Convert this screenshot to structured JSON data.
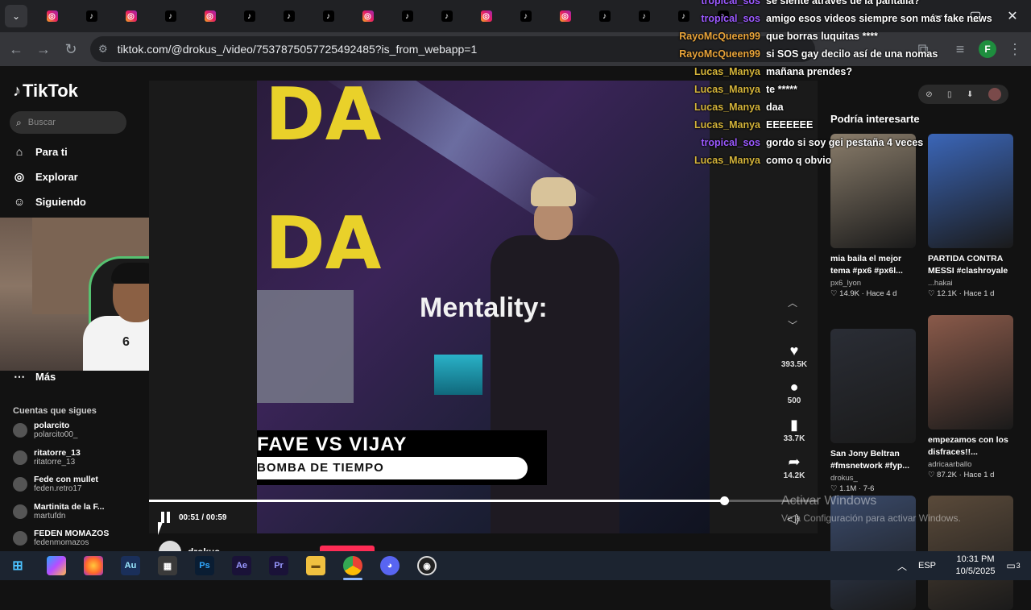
{
  "browser": {
    "url": "tiktok.com/@drokus_/video/7537875057725492485?is_from_webapp=1",
    "profile_initial": "F",
    "tab_favicons": [
      "ig",
      "tk",
      "ig",
      "tk",
      "ig",
      "tk",
      "tk",
      "tk",
      "ig",
      "tk",
      "tk",
      "ig",
      "tk",
      "ig",
      "tk",
      "tk",
      "tk",
      "tk"
    ]
  },
  "tiktok": {
    "logo": "TikTok",
    "search_placeholder": "Buscar",
    "nav": [
      {
        "label": "Para ti",
        "icon": "home-icon"
      },
      {
        "label": "Explorar",
        "icon": "compass-icon"
      },
      {
        "label": "Siguiendo",
        "icon": "people-icon"
      },
      {
        "label": "Más",
        "icon": "more-icon"
      }
    ],
    "following_title": "Cuentas que sigues",
    "following": [
      {
        "name": "polarcito",
        "handle": "polarcito00_"
      },
      {
        "name": "ritatorre_13",
        "handle": "ritatorre_13"
      },
      {
        "name": "Fede con mullet",
        "handle": "feden.retro17"
      },
      {
        "name": "Martinita de la F...",
        "handle": "martufdn"
      },
      {
        "name": "FEDEN MOMAZOS",
        "handle": "fedenmomazos"
      }
    ],
    "video": {
      "overlay_text": "Mentality:",
      "lower_third_title": "FAVE VS VIJAY",
      "lower_third_sub": "BOMBA DE TIEMPO",
      "time": "00:51 / 00:59",
      "progress": 0.86,
      "author": "drokus_"
    },
    "actions": [
      {
        "icon": "heart-icon",
        "value": "393.5K"
      },
      {
        "icon": "comment-icon",
        "value": "500"
      },
      {
        "icon": "bookmark-icon",
        "value": "33.7K"
      },
      {
        "icon": "share-icon",
        "value": "14.2K"
      }
    ],
    "related_title": "Podría interesarte",
    "related": [
      {
        "title": "mia baila el mejor tema #px6 #px6l...",
        "author": "px6_lyon",
        "likes": "14.9K",
        "age": "Hace 4 d",
        "color": "#8a7d6b"
      },
      {
        "title": "PARTIDA CONTRA MESSI #clashroyale",
        "author": "...hakai",
        "likes": "12.1K",
        "age": "Hace 1 d",
        "color": "#3b66b8"
      },
      {
        "title": "San Jony Beltran #fmsnetwork #fyp...",
        "author": "drokus_",
        "likes": "1.1M",
        "age": "7-6",
        "color": "#2a2d35"
      },
      {
        "title": "empezamos con los disfraces!!...",
        "author": "adricaarballo",
        "likes": "87.2K",
        "age": "Hace 1 d",
        "color": "#8a5a4a"
      },
      {
        "title": "",
        "author": "",
        "likes": "",
        "age": "",
        "color": "#3a4a6a"
      },
      {
        "title": "",
        "author": "",
        "likes": "",
        "age": "",
        "color": "#5a4a3a"
      }
    ]
  },
  "chat": [
    {
      "user": "tropical_sos",
      "msg": "se siente atraves de la pantalla?",
      "color": "#9b59ff"
    },
    {
      "user": "tropical_sos",
      "msg": "amigo esos videos siempre son más fake news",
      "color": "#9b59ff"
    },
    {
      "user": "RayoMcQueen99",
      "msg": "que borras luquitas ****",
      "color": "#e9a43a"
    },
    {
      "user": "RayoMcQueen99",
      "msg": "si SOS gay decilo así de una nomas",
      "color": "#e9a43a"
    },
    {
      "user": "Lucas_Manya",
      "msg": "mañana prendes?",
      "color": "#d4b43a"
    },
    {
      "user": "Lucas_Manya",
      "msg": "te *****",
      "color": "#d4b43a"
    },
    {
      "user": "Lucas_Manya",
      "msg": "daa",
      "color": "#d4b43a"
    },
    {
      "user": "Lucas_Manya",
      "msg": "EEEEEEE",
      "color": "#d4b43a"
    },
    {
      "user": "tropical_sos",
      "msg": "gordo si soy gei pestaña 4 veces",
      "color": "#9b59ff"
    },
    {
      "user": "Lucas_Manya",
      "msg": "como q obvio",
      "color": "#d4b43a"
    }
  ],
  "watermark": {
    "line1": "Activar Windows",
    "line2": "Ve a Configuración para activar Windows."
  },
  "taskbar": {
    "apps": [
      "Au",
      "Ps",
      "Ae",
      "Pr"
    ],
    "lang": "ESP",
    "time": "10:31 PM",
    "date": "10/5/2025",
    "notifications": "3"
  }
}
